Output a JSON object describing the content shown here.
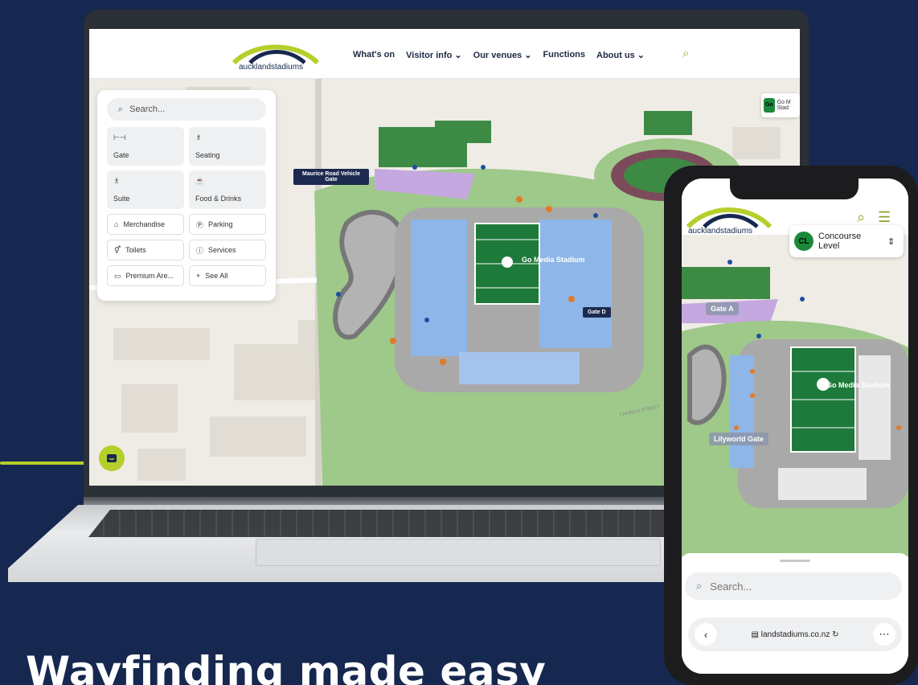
{
  "headline": "Wayfinding made easy",
  "laptop": {
    "header": {
      "logo_text": "aucklandstadiums",
      "nav": [
        "What's on",
        "Visitor info ⌄",
        "Our venues ⌄",
        "Functions",
        "About us ⌄"
      ]
    },
    "panel": {
      "search_placeholder": "Search...",
      "tiles": [
        {
          "label": "Gate",
          "icon": "gate-icon"
        },
        {
          "label": "Seating",
          "icon": "seat-icon"
        },
        {
          "label": "Suite",
          "icon": "suite-icon"
        },
        {
          "label": "Food & Drinks",
          "icon": "food-icon"
        }
      ],
      "chips": [
        {
          "label": "Merchandise",
          "icon": "bag-icon"
        },
        {
          "label": "Parking",
          "icon": "parking-icon"
        },
        {
          "label": "Toilets",
          "icon": "toilets-icon"
        },
        {
          "label": "Services",
          "icon": "info-icon"
        },
        {
          "label": "Premium Are...",
          "icon": "premium-icon"
        },
        {
          "label": "See All",
          "icon": "plus-icon"
        }
      ]
    },
    "map_labels": {
      "maurice_gate": "Maurice Road Vehicle Gate",
      "gate_d": "Gate D",
      "stadium": "Go Media Stadium",
      "street": "CHURCH STREET",
      "go_badge_icon": "Go",
      "go_badge_text": "Go M Stad"
    }
  },
  "phone": {
    "logo_text": "aucklandstadiums",
    "level": {
      "badge": "CL",
      "name": "Concourse Level"
    },
    "labels": {
      "gate_a": "Gate A",
      "stadium": "Go Media Stadium",
      "lilyworld": "Lilyworld Gate"
    },
    "search_placeholder": "Search...",
    "url": "landstadiums.co.nz"
  },
  "colors": {
    "brand_green": "#b5cf2b",
    "navy": "#16284f",
    "field": "#1e7a3a"
  }
}
